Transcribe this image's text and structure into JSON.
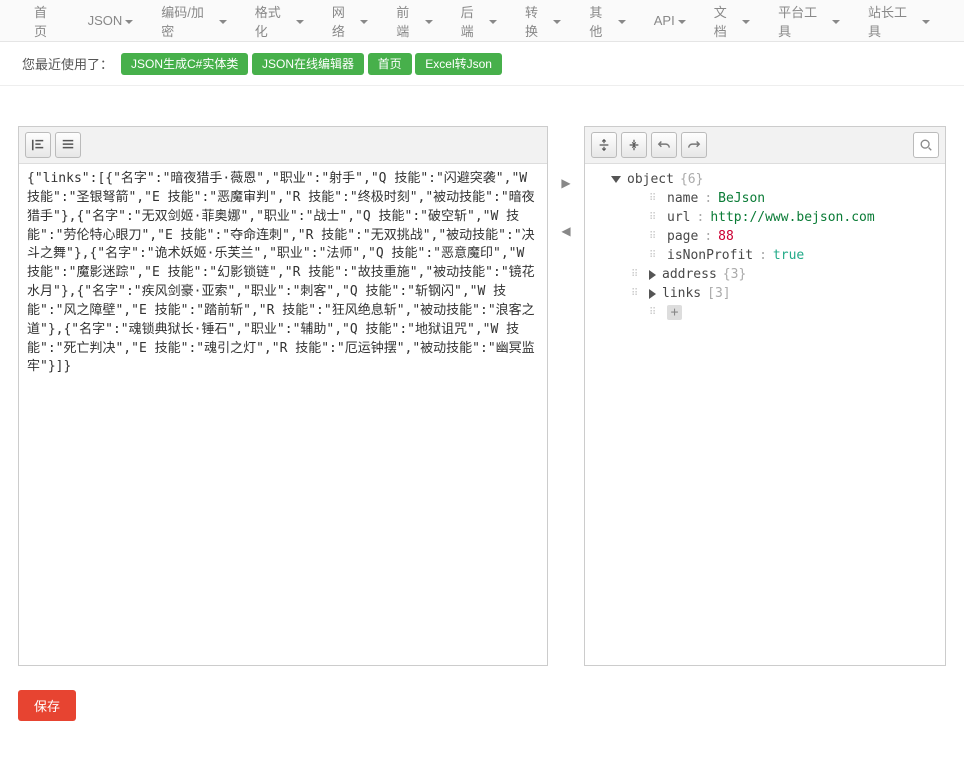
{
  "nav": {
    "items": [
      {
        "label": "首页",
        "dropdown": false
      },
      {
        "label": "JSON",
        "dropdown": true
      },
      {
        "label": "编码/加密",
        "dropdown": true
      },
      {
        "label": "格式化",
        "dropdown": true
      },
      {
        "label": "网络",
        "dropdown": true
      },
      {
        "label": "前端",
        "dropdown": true
      },
      {
        "label": "后端",
        "dropdown": true
      },
      {
        "label": "转换",
        "dropdown": true
      },
      {
        "label": "其他",
        "dropdown": true
      },
      {
        "label": "API",
        "dropdown": true
      },
      {
        "label": "文档",
        "dropdown": true
      },
      {
        "label": "平台工具",
        "dropdown": true
      },
      {
        "label": "站长工具",
        "dropdown": true
      }
    ]
  },
  "recent": {
    "label": "您最近使用了：",
    "tags": [
      "JSON生成C#实体类",
      "JSON在线编辑器",
      "首页",
      "Excel转Json"
    ]
  },
  "source_code": "{\"links\":[{\"名字\":\"暗夜猎手·薇恩\",\"职业\":\"射手\",\"Q 技能\":\"闪避突袭\",\"W 技能\":\"圣银弩箭\",\"E 技能\":\"恶魔审判\",\"R 技能\":\"终极时刻\",\"被动技能\":\"暗夜猎手\"},{\"名字\":\"无双剑姬·菲奥娜\",\"职业\":\"战士\",\"Q 技能\":\"破空斩\",\"W 技能\":\"劳伦特心眼刀\",\"E 技能\":\"夺命连刺\",\"R 技能\":\"无双挑战\",\"被动技能\":\"决斗之舞\"},{\"名字\":\"诡术妖姬·乐芙兰\",\"职业\":\"法师\",\"Q 技能\":\"恶意魔印\",\"W 技能\":\"魔影迷踪\",\"E 技能\":\"幻影锁链\",\"R 技能\":\"故技重施\",\"被动技能\":\"镜花水月\"},{\"名字\":\"疾风剑豪·亚索\",\"职业\":\"刺客\",\"Q 技能\":\"斩钢闪\",\"W 技能\":\"风之障壁\",\"E 技能\":\"踏前斩\",\"R 技能\":\"狂风绝息斩\",\"被动技能\":\"浪客之道\"},{\"名字\":\"魂锁典狱长·锤石\",\"职业\":\"辅助\",\"Q 技能\":\"地狱诅咒\",\"W 技能\":\"死亡判决\",\"E 技能\":\"魂引之灯\",\"R 技能\":\"厄运钟摆\",\"被动技能\":\"幽冥监牢\"}]}",
  "tree": {
    "root_label": "object",
    "root_count": "{6}",
    "props": [
      {
        "key": "name",
        "value": "BeJson",
        "type": "str"
      },
      {
        "key": "url",
        "value": "http://www.bejson.com",
        "type": "str"
      },
      {
        "key": "page",
        "value": "88",
        "type": "num"
      },
      {
        "key": "isNonProfit",
        "value": "true",
        "type": "bool"
      }
    ],
    "collapsed": [
      {
        "key": "address",
        "meta": "{3}"
      },
      {
        "key": "links",
        "meta": "[3]"
      }
    ]
  },
  "buttons": {
    "save": "保存"
  }
}
